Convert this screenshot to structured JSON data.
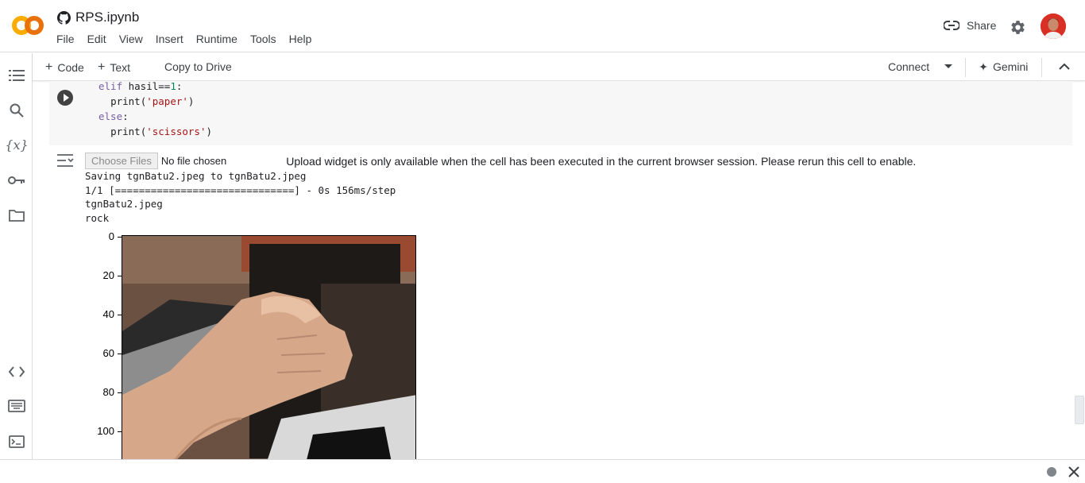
{
  "app": {
    "title": "RPS.ipynb",
    "brand_colors": {
      "logo_orange": "#F9AB00",
      "logo_dark": "#E8710A"
    }
  },
  "menu": [
    "File",
    "Edit",
    "View",
    "Insert",
    "Runtime",
    "Tools",
    "Help"
  ],
  "header": {
    "share_label": "Share"
  },
  "sidebar": {
    "icons": [
      "table-of-contents-icon",
      "search-icon",
      "variables-icon",
      "secrets-key-icon",
      "files-folder-icon",
      "code-snippets-icon",
      "command-palette-icon",
      "terminal-icon"
    ],
    "variables_glyph": "{x}"
  },
  "toolbar": {
    "add_code": "Code",
    "add_text": "Text",
    "copy_to_drive": "Copy to Drive",
    "connect": "Connect",
    "gemini": "Gemini"
  },
  "code_cell": {
    "lines": [
      {
        "indent": "",
        "kw": "elif",
        "rest": " hasil==",
        "num": "1",
        "tail": ":"
      },
      {
        "indent": "  ",
        "fn": "print(",
        "str": "'paper'",
        "close": ")"
      },
      {
        "indent": "",
        "kw": "else",
        "rest": ":"
      },
      {
        "indent": "  ",
        "fn": "print(",
        "str": "'scissors'",
        "close": ")"
      }
    ]
  },
  "output": {
    "choose_files": "Choose Files",
    "no_file": "No file chosen",
    "upload_message": "Upload widget is only available when the cell has been executed in the current browser session. Please rerun this cell to enable.",
    "stdout_lines": [
      "Saving tgnBatu2.jpeg to tgnBatu2.jpeg",
      "1/1 [==============================] - 0s 156ms/step",
      "tgnBatu2.jpeg",
      "rock"
    ],
    "plot": {
      "y_ticks": [
        "0",
        "20",
        "40",
        "60",
        "80",
        "100"
      ]
    }
  }
}
